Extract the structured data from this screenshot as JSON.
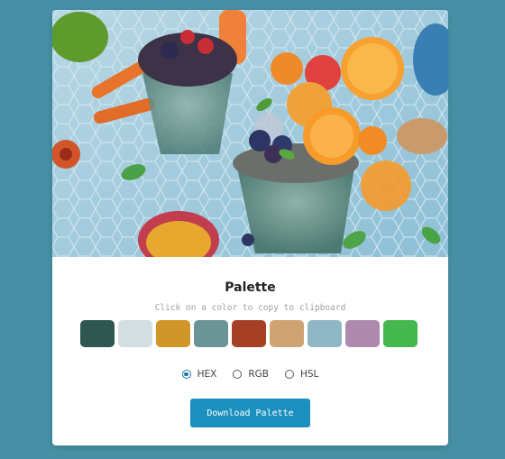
{
  "palette": {
    "title": "Palette",
    "hint": "Click on a color to copy to clipboard",
    "colors": [
      "#2e5752",
      "#d2dee2",
      "#d0962a",
      "#6b9496",
      "#a64024",
      "#d0a373",
      "#8fb7c6",
      "#ae8aae",
      "#45b84d"
    ]
  },
  "formats": {
    "options": [
      {
        "label": "HEX",
        "selected": true
      },
      {
        "label": "RGB",
        "selected": false
      },
      {
        "label": "HSL",
        "selected": false
      }
    ]
  },
  "actions": {
    "download_label": "Download Palette"
  },
  "theme": {
    "background": "#468fa5",
    "accent": "#1b8fbe"
  }
}
